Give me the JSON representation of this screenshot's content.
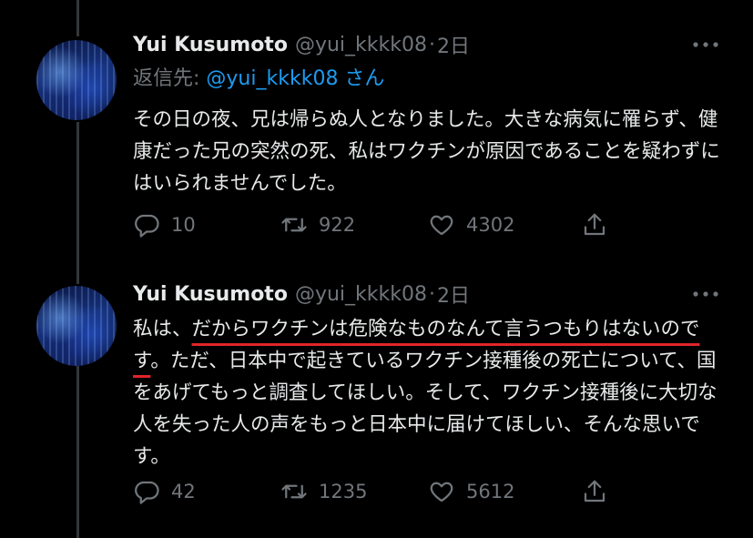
{
  "tweets": [
    {
      "author_name": "Yui Kusumoto",
      "author_handle": "@yui_kkkk08",
      "separator": "·",
      "time": "2日",
      "reply_prefix": "返信先: ",
      "reply_mention": "@yui_kkkk08",
      "reply_suffix": " さん",
      "text": "その日の夜、兄は帰らぬ人となりました。大きな病気に罹らず、健康だった兄の突然の死、私はワクチンが原因であることを疑わずにはいられませんでした。",
      "replies": "10",
      "retweets": "922",
      "likes": "4302",
      "more_icon": "more-icon"
    },
    {
      "author_name": "Yui Kusumoto",
      "author_handle": "@yui_kkkk08",
      "separator": "·",
      "time": "2日",
      "text_before": "私は、",
      "text_underlined": "だからワクチンは危険なものなんて言うつもりはないのです",
      "text_after": "。ただ、日本中で起きているワクチン接種後の死亡について、国をあげてもっと調査してほしい。そして、ワクチン接種後に大切な人を失った人の声をもっと日本中に届けてほしい、そんな思いです。",
      "replies": "42",
      "retweets": "1235",
      "likes": "5612",
      "highlight_color": "#e0242b"
    }
  ]
}
